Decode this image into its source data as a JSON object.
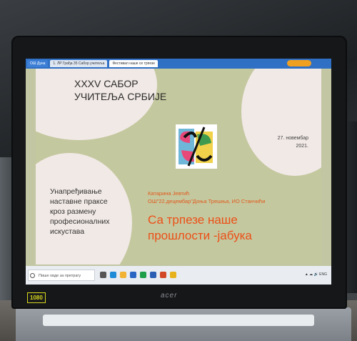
{
  "browser": {
    "tabs": [
      "ОШ Дуна",
      "1. ЛР Грађа 35 Сабор учитеља",
      "Фестивал наше се трпезе"
    ]
  },
  "slide": {
    "title_line1": "XXXV САБОР",
    "title_line2": "УЧИТЕЉА СРБИЈЕ",
    "date_line1": "27. новембар",
    "date_line2": "2021.",
    "left_lines": [
      "Унапређивање",
      "наставне праксе",
      "кроз размену",
      "професионалних",
      "искустава"
    ],
    "author_line1": "Катарина Јевтић",
    "author_line2": "ОШ\"22.децембар\"Доња Трешња, ИО Станчићи",
    "headline": "Са трпезе наше прошлости -јабука"
  },
  "taskbar": {
    "search_placeholder": "Пише овде за претрагу"
  },
  "laptop": {
    "brand": "acer",
    "badge": "1080"
  },
  "colors": {
    "slide_bg": "#c4c89f",
    "blob": "#f1e9e6",
    "accent_orange": "#ec4f17",
    "browser_bar": "#2f6fc4"
  }
}
